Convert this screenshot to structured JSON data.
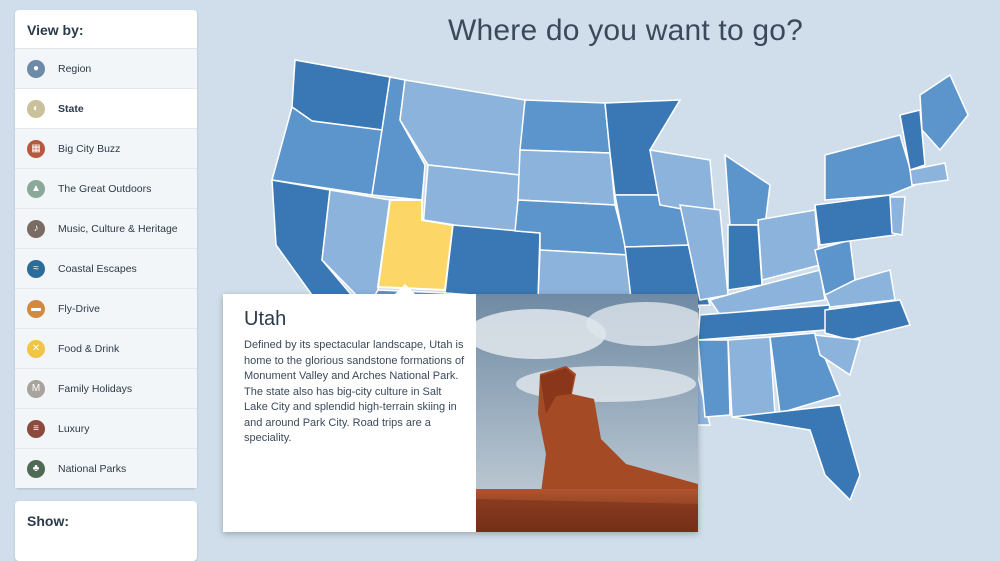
{
  "sidebar": {
    "heading": "View by:",
    "items": [
      {
        "label": "Region",
        "icon": "map-pin-icon",
        "color": "#6d8aa8",
        "glyph": "●"
      },
      {
        "label": "State",
        "icon": "state-icon",
        "color": "#c9c19a",
        "glyph": "◐"
      },
      {
        "label": "Big City Buzz",
        "icon": "city-icon",
        "color": "#b8583e",
        "glyph": "▦"
      },
      {
        "label": "The Great Outdoors",
        "icon": "mountain-icon",
        "color": "#8aa99b",
        "glyph": "▲"
      },
      {
        "label": "Music, Culture & Heritage",
        "icon": "music-icon",
        "color": "#7a6b63",
        "glyph": "♪"
      },
      {
        "label": "Coastal Escapes",
        "icon": "wave-icon",
        "color": "#2a6c9a",
        "glyph": "≈"
      },
      {
        "label": "Fly-Drive",
        "icon": "car-icon",
        "color": "#d38a3f",
        "glyph": "▬"
      },
      {
        "label": "Food & Drink",
        "icon": "utensils-icon",
        "color": "#f0c445",
        "glyph": "✕"
      },
      {
        "label": "Family Holidays",
        "icon": "family-icon",
        "color": "#a8a39c",
        "glyph": "M"
      },
      {
        "label": "Luxury",
        "icon": "luxury-icon",
        "color": "#8a4a3c",
        "glyph": "≡"
      },
      {
        "label": "National Parks",
        "icon": "tree-icon",
        "color": "#4e6a55",
        "glyph": "♣"
      }
    ],
    "active_index": 1
  },
  "show": {
    "heading": "Show:"
  },
  "title": "Where do you want to go?",
  "popup": {
    "state": "Utah",
    "description": "Defined by its spectacular landscape, Utah is home to the glorious sandstone formations of Monument Valley and Arches National Park. The state also has big-city culture in Salt Lake City and splendid high-terrain skiing in and around Park City. Road trips are a speciality."
  },
  "colors": {
    "highlight": "#fdd668",
    "state_dark": "#3a78b5",
    "state_mid": "#5b95cc",
    "state_light": "#8cb3dc",
    "background": "#cfdeea"
  }
}
